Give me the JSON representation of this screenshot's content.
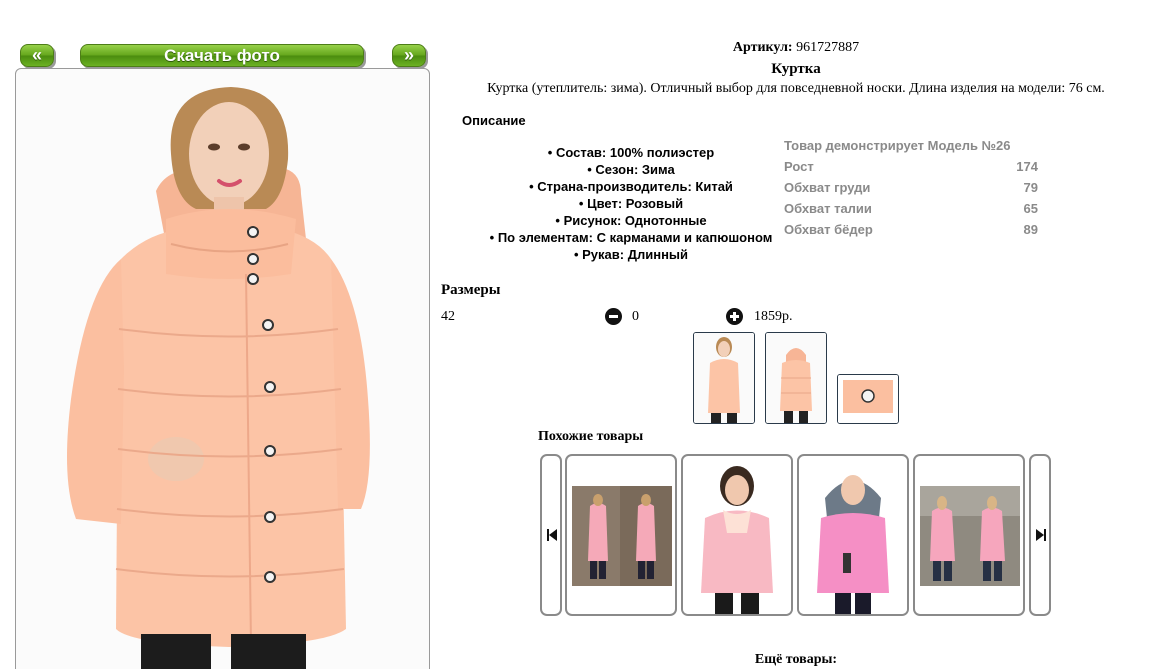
{
  "gallery": {
    "prev_label": "«",
    "download_label": "Скачать фото",
    "next_label": "»"
  },
  "product": {
    "sku_label": "Артикул:",
    "sku_value": "961727887",
    "title": "Куртка",
    "description": "Куртка (утеплитель: зима). Отличный выбор для повседневной носки. Длина изделия на модели: 76 см.",
    "jacket_color": "#fcc4a6"
  },
  "description_section": {
    "heading": "Описание",
    "specs": [
      "Состав: 100% полиэстер",
      "Сезон: Зима",
      "Страна-производитель: Китай",
      "Цвет: Розовый",
      "Рисунок: Однотонные",
      "По элементам: С карманами и капюшоном",
      "Рукав: Длинный"
    ]
  },
  "model": {
    "title": "Товар демонстрирует Модель №26",
    "rows": [
      {
        "label": "Рост",
        "value": "174"
      },
      {
        "label": "Обхват груди",
        "value": "79"
      },
      {
        "label": "Обхват талии",
        "value": "65"
      },
      {
        "label": "Обхват бёдер",
        "value": "89"
      }
    ]
  },
  "sizes": {
    "heading": "Размеры",
    "size": "42",
    "quantity": "0",
    "price": "1859р."
  },
  "similar": {
    "heading": "Похожие товары",
    "items": [
      "similar-item-1",
      "similar-item-2",
      "similar-item-3",
      "similar-item-4"
    ]
  },
  "more": {
    "heading": "Ещё товары:"
  }
}
